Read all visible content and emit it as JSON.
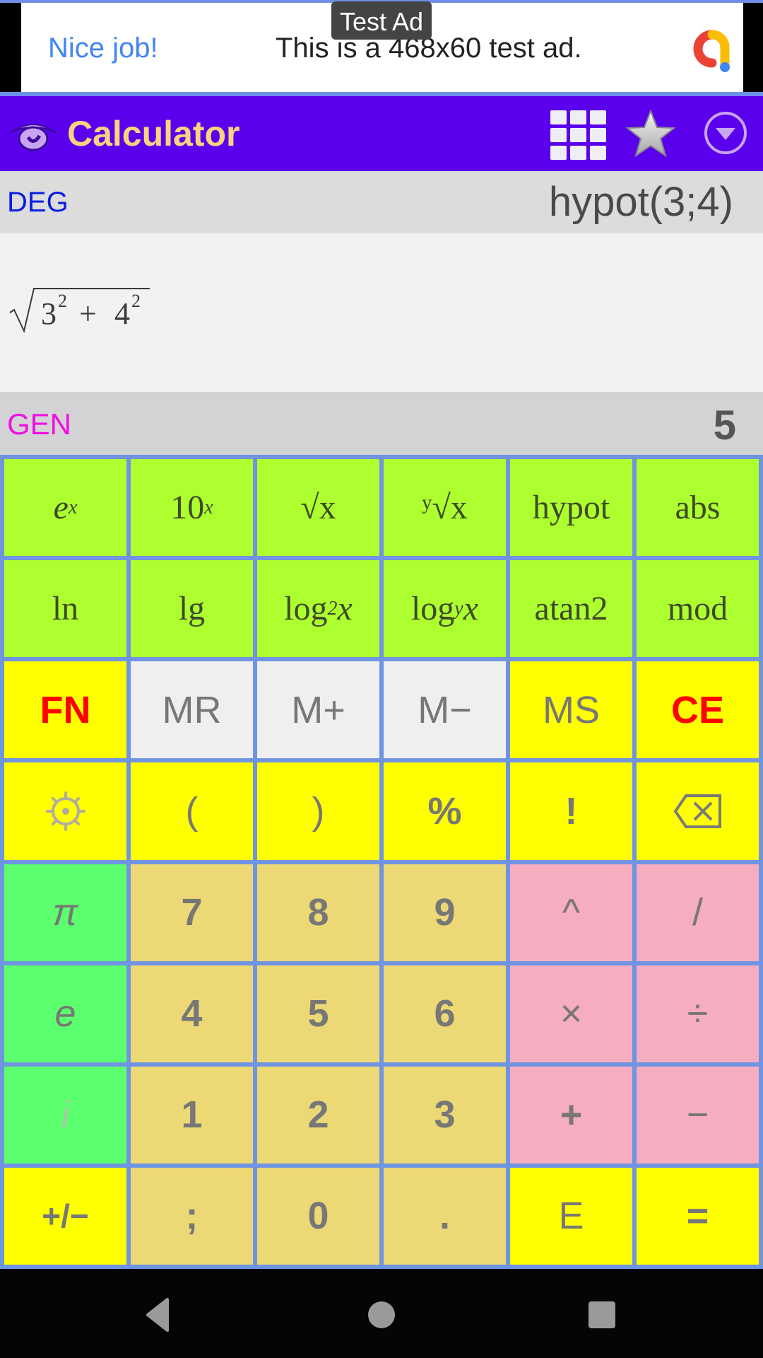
{
  "ad": {
    "badge": "Test Ad",
    "headline": "Nice job!",
    "text": "This is a 468x60 test ad."
  },
  "appbar": {
    "title": "Calculator",
    "icons": [
      "eye-icon",
      "grid-icon",
      "star-icon",
      "dropdown-menu-icon"
    ]
  },
  "display": {
    "angle_mode": "DEG",
    "expression": "hypot(3;4)",
    "formula": "√(3² + 4²)",
    "format_mode": "GEN",
    "result": "5"
  },
  "keypad": {
    "rows": [
      [
        {
          "label": "eˣ",
          "name": "key-exp",
          "base": "e",
          "sup": "x"
        },
        {
          "label": "10ˣ",
          "name": "key-pow10",
          "base": "10",
          "sup": "x"
        },
        {
          "label": "√x",
          "name": "key-sqrt"
        },
        {
          "label": "ʸ√x",
          "name": "key-nth-root"
        },
        {
          "label": "hypot",
          "name": "key-hypot"
        },
        {
          "label": "abs",
          "name": "key-abs"
        }
      ],
      [
        {
          "label": "ln",
          "name": "key-ln"
        },
        {
          "label": "lg",
          "name": "key-lg"
        },
        {
          "label": "log₂x",
          "name": "key-log2",
          "base": "log",
          "sub": "2",
          "after": "x"
        },
        {
          "label": "logᵧx",
          "name": "key-logy",
          "base": "log",
          "sub": "y",
          "after": "x"
        },
        {
          "label": "atan2",
          "name": "key-atan2"
        },
        {
          "label": "mod",
          "name": "key-mod"
        }
      ],
      [
        {
          "label": "FN",
          "name": "key-fn"
        },
        {
          "label": "MR",
          "name": "key-mr"
        },
        {
          "label": "M+",
          "name": "key-m-plus"
        },
        {
          "label": "M−",
          "name": "key-m-minus"
        },
        {
          "label": "MS",
          "name": "key-ms"
        },
        {
          "label": "CE",
          "name": "key-ce"
        }
      ],
      [
        {
          "label": "settings-icon",
          "name": "key-settings"
        },
        {
          "label": "(",
          "name": "key-open-paren"
        },
        {
          "label": ")",
          "name": "key-close-paren"
        },
        {
          "label": "%",
          "name": "key-percent"
        },
        {
          "label": "!",
          "name": "key-factorial"
        },
        {
          "label": "backspace-icon",
          "name": "key-backspace"
        }
      ],
      [
        {
          "label": "π",
          "name": "key-pi"
        },
        {
          "label": "7",
          "name": "key-7"
        },
        {
          "label": "8",
          "name": "key-8"
        },
        {
          "label": "9",
          "name": "key-9"
        },
        {
          "label": "^",
          "name": "key-power"
        },
        {
          "label": "/",
          "name": "key-slash"
        }
      ],
      [
        {
          "label": "e",
          "name": "key-e"
        },
        {
          "label": "4",
          "name": "key-4"
        },
        {
          "label": "5",
          "name": "key-5"
        },
        {
          "label": "6",
          "name": "key-6"
        },
        {
          "label": "×",
          "name": "key-multiply"
        },
        {
          "label": "÷",
          "name": "key-divide"
        }
      ],
      [
        {
          "label": "i",
          "name": "key-imaginary"
        },
        {
          "label": "1",
          "name": "key-1"
        },
        {
          "label": "2",
          "name": "key-2"
        },
        {
          "label": "3",
          "name": "key-3"
        },
        {
          "label": "+",
          "name": "key-plus"
        },
        {
          "label": "−",
          "name": "key-minus"
        }
      ],
      [
        {
          "label": "+/−",
          "name": "key-negate"
        },
        {
          "label": ";",
          "name": "key-semicolon"
        },
        {
          "label": "0",
          "name": "key-0"
        },
        {
          "label": ".",
          "name": "key-decimal"
        },
        {
          "label": "E",
          "name": "key-exponent"
        },
        {
          "label": "=",
          "name": "key-equals"
        }
      ]
    ]
  },
  "colors": {
    "appbar": "#5b00ec",
    "title": "#f7d57e",
    "deg": "#0a1ee0",
    "gen": "#ef10e0",
    "key_border": "#6f94e2",
    "lime": "#adff2f",
    "yellow": "#ffff00",
    "sand": "#ecd975",
    "pink": "#f6adbf",
    "green": "#5cff6d",
    "memory_gray": "#efefef",
    "red_text": "#ff0000"
  },
  "navbar": {
    "buttons": [
      "back-icon",
      "home-icon",
      "recents-icon"
    ]
  }
}
